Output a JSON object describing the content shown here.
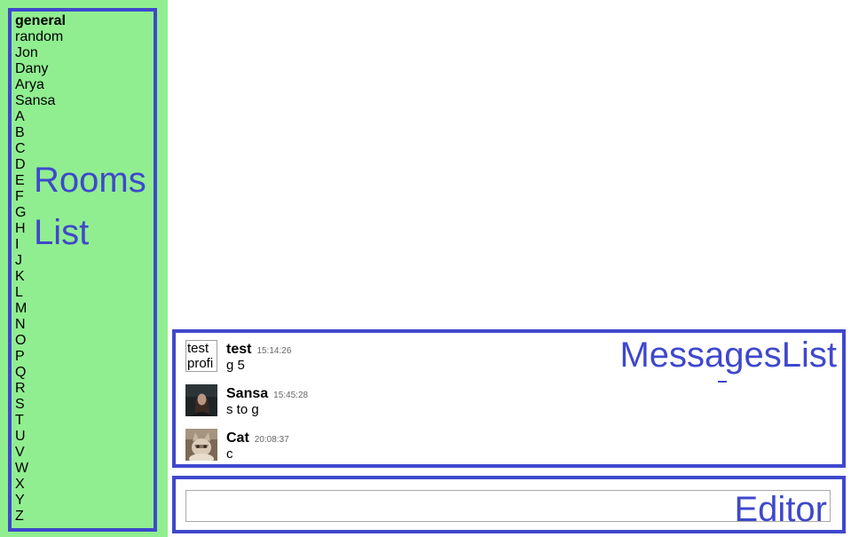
{
  "rooms": {
    "annotation_line1": "Rooms",
    "annotation_line2": "List",
    "active": "general",
    "items": [
      "general",
      "random",
      "Jon",
      "Dany",
      "Arya",
      "Sansa",
      "A",
      "B",
      "C",
      "D",
      "E",
      "F",
      "G",
      "H",
      "I",
      "J",
      "K",
      "L",
      "M",
      "N",
      "O",
      "P",
      "Q",
      "R",
      "S",
      "T",
      "U",
      "V",
      "W",
      "X",
      "Y",
      "Z"
    ]
  },
  "messages": {
    "annotation": "MessagesList",
    "items": [
      {
        "author": "test",
        "time": "15:14:26",
        "text": "g 5",
        "avatar_alt": "test profi",
        "avatar_broken": true
      },
      {
        "author": "Sansa",
        "time": "15:45:28",
        "text": "s to g",
        "avatar_alt": "Sansa",
        "avatar_broken": false
      },
      {
        "author": "Cat",
        "time": "20:08:37",
        "text": "c",
        "avatar_alt": "Cat",
        "avatar_broken": false
      }
    ]
  },
  "editor": {
    "annotation": "Editor",
    "value": "",
    "placeholder": ""
  },
  "colors": {
    "sidebar_bg": "#90ee90",
    "annotation_blue": "#3f48cc"
  }
}
